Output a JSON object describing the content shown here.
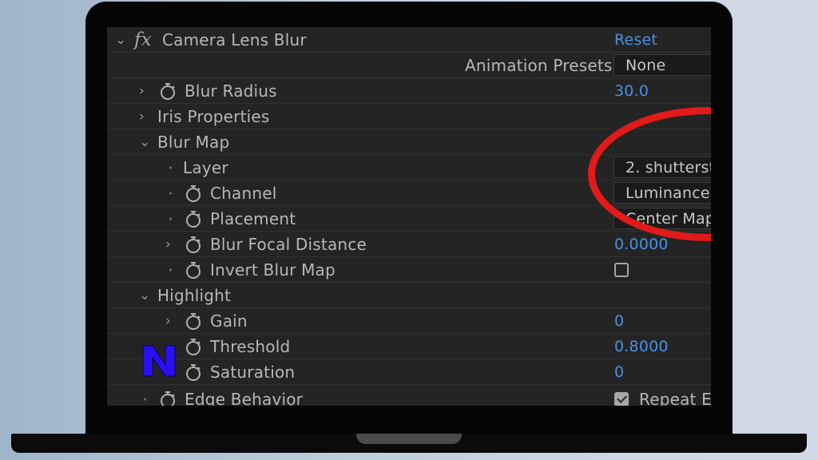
{
  "effect": {
    "icon_text": "fx",
    "name": "Camera Lens Blur",
    "reset_label": "Reset",
    "presets_label": "Animation Presets:",
    "presets_value": "None"
  },
  "properties": {
    "blur_radius": {
      "label": "Blur Radius",
      "value": "30.0"
    },
    "iris_properties": {
      "label": "Iris Properties"
    },
    "blur_map": {
      "label": "Blur Map",
      "layer": {
        "label": "Layer",
        "value": "2. shutterst"
      },
      "channel": {
        "label": "Channel",
        "value": "Luminance"
      },
      "placement": {
        "label": "Placement",
        "value": "Center Map"
      },
      "blur_focal_distance": {
        "label": "Blur Focal Distance",
        "value": "0.0000"
      },
      "invert_blur_map": {
        "label": "Invert Blur Map"
      }
    },
    "highlight": {
      "label": "Highlight",
      "gain": {
        "label": "Gain",
        "value": "0"
      },
      "threshold": {
        "label": "Threshold",
        "value": "0.8000"
      },
      "saturation": {
        "label": "Saturation",
        "value": "0"
      }
    },
    "edge_behavior": {
      "label": "Edge Behavior",
      "value": "Repeat Ed"
    }
  },
  "colors": {
    "value_blue": "#4a90e2",
    "annotation_red": "#e11a1a",
    "watermark_blue": "#2a10f0"
  }
}
